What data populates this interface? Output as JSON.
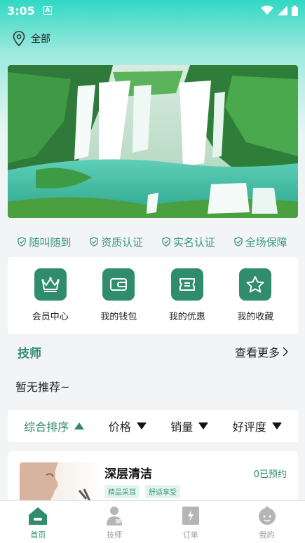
{
  "status_bar": {
    "time": "3:05",
    "notification_letter": "A"
  },
  "location": {
    "label": "全部"
  },
  "features": [
    {
      "label": "随叫随到"
    },
    {
      "label": "资质认证"
    },
    {
      "label": "实名认证"
    },
    {
      "label": "全场保障"
    }
  ],
  "quick_actions": [
    {
      "label": "会员中心",
      "icon": "crown-icon"
    },
    {
      "label": "我的钱包",
      "icon": "wallet-icon"
    },
    {
      "label": "我的优惠",
      "icon": "coupon-icon"
    },
    {
      "label": "我的收藏",
      "icon": "star-icon"
    }
  ],
  "technicians": {
    "title": "技师",
    "more_label": "查看更多",
    "empty_text": "暂无推荐~"
  },
  "sort_bar": [
    {
      "label": "综合排序",
      "active": true
    },
    {
      "label": "价格",
      "active": false
    },
    {
      "label": "销量",
      "active": false
    },
    {
      "label": "好评度",
      "active": false
    }
  ],
  "product": {
    "name": "深层清洁",
    "booked": "0已预约",
    "tags": [
      "精品采耳",
      "舒适享受"
    ]
  },
  "tabbar": [
    {
      "label": "首页",
      "active": true,
      "icon": "home-icon"
    },
    {
      "label": "技师",
      "active": false,
      "icon": "technician-icon"
    },
    {
      "label": "订单",
      "active": false,
      "icon": "order-icon"
    },
    {
      "label": "我的",
      "active": false,
      "icon": "profile-icon"
    }
  ],
  "colors": {
    "accent": "#2f8c6c",
    "accent_light": "#3a9a7d",
    "gradient_top": "#30d8c4"
  }
}
